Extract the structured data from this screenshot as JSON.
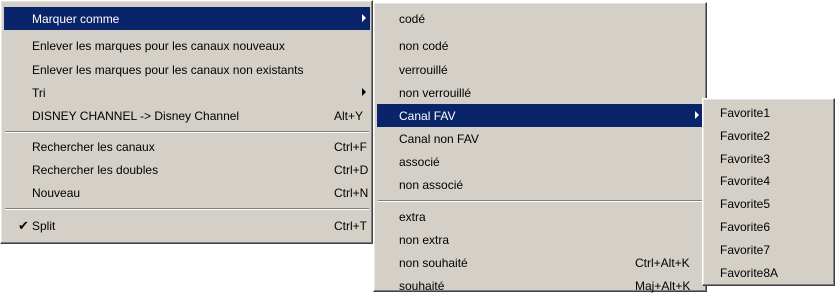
{
  "menu1": {
    "items": [
      {
        "label": "Marquer comme",
        "shortcut": "",
        "arrow": true
      },
      {
        "label": "Enlever les marques pour les canaux nouveaux",
        "shortcut": ""
      },
      {
        "label": "Enlever les marques pour les canaux non existants",
        "shortcut": ""
      },
      {
        "label": "Tri",
        "shortcut": "",
        "arrow": true
      },
      {
        "label": "DISNEY CHANNEL -> Disney Channel",
        "shortcut": "Alt+Y"
      },
      {
        "label": "Rechercher les canaux",
        "shortcut": "Ctrl+F"
      },
      {
        "label": "Rechercher les doubles",
        "shortcut": "Ctrl+D"
      },
      {
        "label": "Nouveau",
        "shortcut": "Ctrl+N"
      },
      {
        "label": "Split",
        "shortcut": "Ctrl+T",
        "checked": true
      }
    ],
    "check_glyph": "✔"
  },
  "menu2": {
    "items": [
      {
        "label": "codé",
        "shortcut": ""
      },
      {
        "label": "non codé",
        "shortcut": ""
      },
      {
        "label": "verrouillé",
        "shortcut": ""
      },
      {
        "label": "non verrouillé",
        "shortcut": ""
      },
      {
        "label": "Canal FAV",
        "shortcut": "",
        "arrow": true
      },
      {
        "label": "Canal non FAV",
        "shortcut": ""
      },
      {
        "label": "associé",
        "shortcut": ""
      },
      {
        "label": "non associé",
        "shortcut": ""
      },
      {
        "label": "extra",
        "shortcut": ""
      },
      {
        "label": "non extra",
        "shortcut": ""
      },
      {
        "label": "non souhaité",
        "shortcut": "Ctrl+Alt+K"
      },
      {
        "label": "souhaité",
        "shortcut": "Maj+Alt+K"
      }
    ]
  },
  "menu3": {
    "items": [
      {
        "label": "Favorite1"
      },
      {
        "label": "Favorite2"
      },
      {
        "label": "Favorite3"
      },
      {
        "label": "Favorite4"
      },
      {
        "label": "Favorite5"
      },
      {
        "label": "Favorite6"
      },
      {
        "label": "Favorite7"
      },
      {
        "label": "Favorite8A"
      }
    ]
  },
  "colors": {
    "menu_bg": "#d4d0c8",
    "highlight": "#0a246a",
    "highlight_text": "#ffffff"
  }
}
